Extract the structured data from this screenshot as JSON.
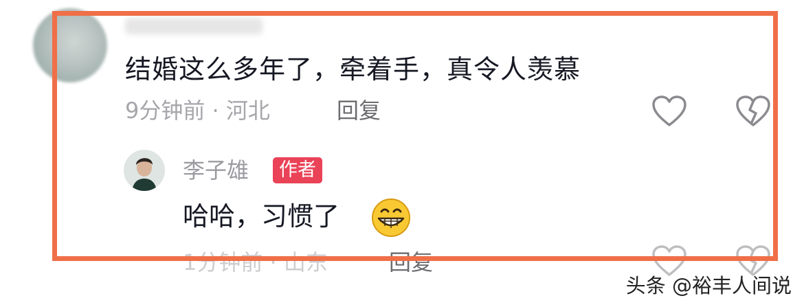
{
  "comment": {
    "text": "结婚这么多年了，牵着手，真令人羡慕",
    "meta": "9分钟前 · 河北",
    "reply_label": "回复"
  },
  "reply": {
    "author": "李子雄",
    "badge": "作者",
    "text": "哈哈，习惯了",
    "emoji": "grinning-face-icon",
    "meta": "1分钟前 · 山东",
    "reply_label": "回复"
  },
  "watermark": "头条 @裕丰人间说",
  "colors": {
    "highlight_border": "#ef6f48",
    "author_badge": "#ea4257",
    "meta_text": "#a6a6ab"
  }
}
